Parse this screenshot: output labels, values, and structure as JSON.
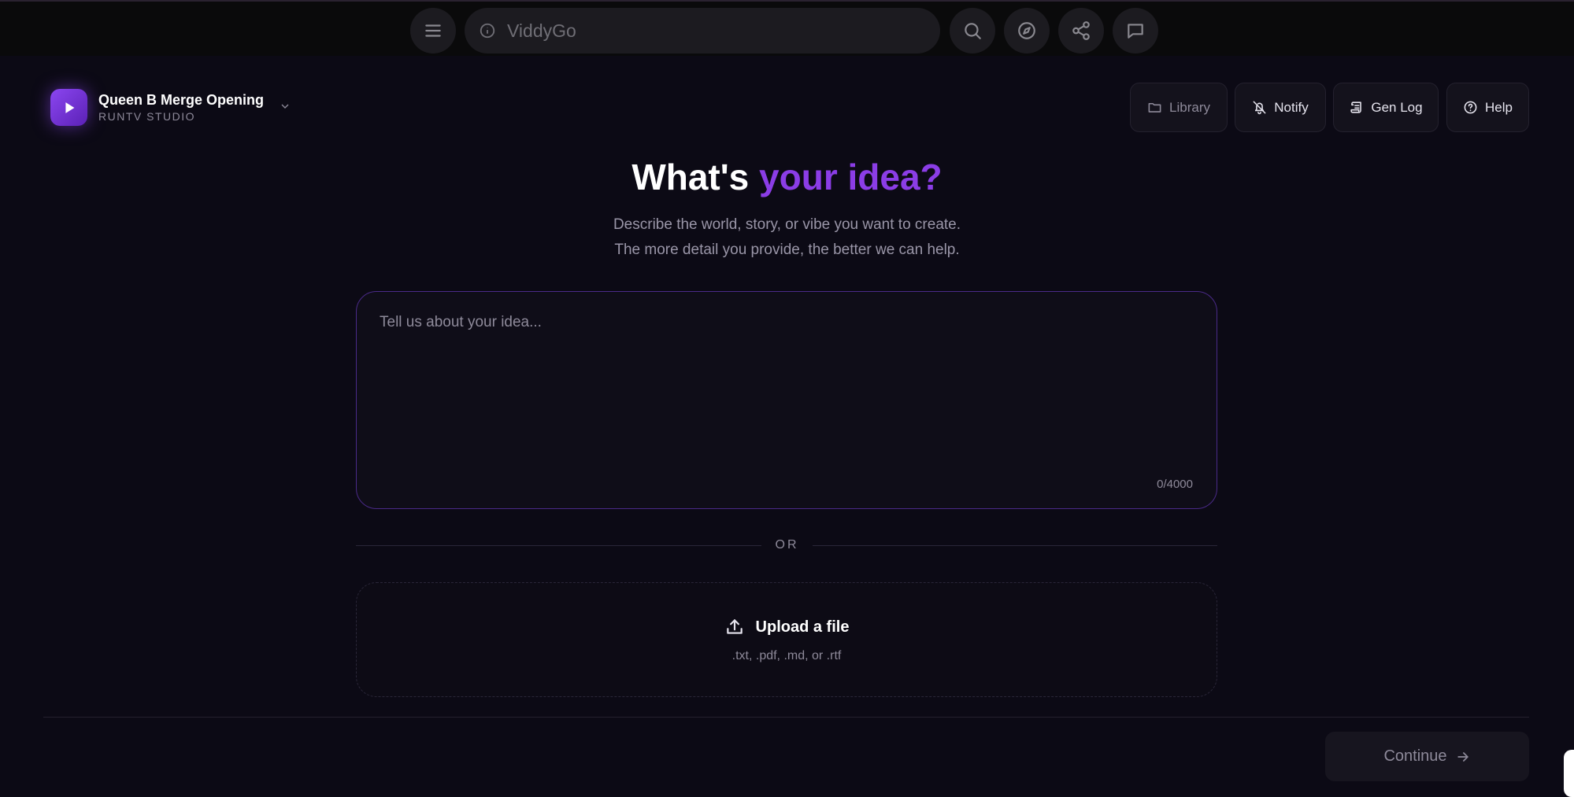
{
  "browser": {
    "address_text": "ViddyGo",
    "icons": [
      "menu-icon",
      "info-icon",
      "search-icon",
      "compass-icon",
      "share-icon",
      "chat-icon"
    ]
  },
  "project": {
    "title": "Queen B Merge Opening",
    "subtitle": "RUNTV STUDIO"
  },
  "header_buttons": {
    "library": "Library",
    "notify": "Notify",
    "gen_log": "Gen Log",
    "help": "Help"
  },
  "hero": {
    "title_plain": "What's ",
    "title_accent": "your idea?",
    "line1": "Describe the world, story, or vibe you want to create.",
    "line2": "The more detail you provide, the better we can help."
  },
  "idea_input": {
    "placeholder": "Tell us about your idea...",
    "value": "",
    "counter": "0/4000"
  },
  "divider": {
    "label": "OR"
  },
  "upload": {
    "label": "Upload a file",
    "types": ".txt, .pdf, .md, or .rtf"
  },
  "footer": {
    "continue_label": "Continue"
  },
  "colors": {
    "background": "#0c0a15",
    "accent": "#8b3de6",
    "panel": "#14121c",
    "muted_text": "#8e8a9a"
  }
}
